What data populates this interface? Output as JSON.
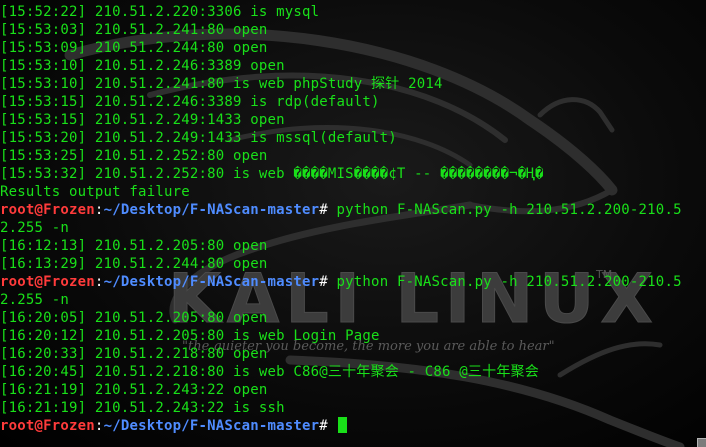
{
  "terminal": {
    "lines": [
      {
        "type": "output",
        "text": "[15:52:22] 210.51.2.220:3306 is mysql"
      },
      {
        "type": "output",
        "text": "[15:53:03] 210.51.2.241:80 open"
      },
      {
        "type": "output",
        "text": "[15:53:09] 210.51.2.244:80 open"
      },
      {
        "type": "output",
        "text": "[15:53:10] 210.51.2.246:3389 open"
      },
      {
        "type": "output",
        "text": "[15:53:10] 210.51.2.241:80 is web phpStudy 探针 2014"
      },
      {
        "type": "output",
        "text": "[15:53:15] 210.51.2.246:3389 is rdp(default)"
      },
      {
        "type": "output",
        "text": "[15:53:15] 210.51.2.249:1433 open"
      },
      {
        "type": "output",
        "text": "[15:53:20] 210.51.2.249:1433 is mssql(default)"
      },
      {
        "type": "output",
        "text": "[15:53:25] 210.51.2.252:80 open"
      },
      {
        "type": "output",
        "text": "[15:53:32] 210.51.2.252:80 is web ����MIS����¢T -- ��������¬�Ң�"
      },
      {
        "type": "output",
        "text": "Results output failure"
      },
      {
        "type": "prompt",
        "user": "root@Frozen",
        "sep": ":",
        "path": "~/Desktop/F-NAScan-master",
        "hash": "# ",
        "cmd": "python F-NAScan.py -h 210.51.2.200-210.5"
      },
      {
        "type": "output",
        "text": "2.255 -n"
      },
      {
        "type": "output",
        "text": "[16:12:13] 210.51.2.205:80 open"
      },
      {
        "type": "output",
        "text": "[16:13:29] 210.51.2.244:80 open"
      },
      {
        "type": "prompt",
        "user": "root@Frozen",
        "sep": ":",
        "path": "~/Desktop/F-NAScan-master",
        "hash": "# ",
        "cmd": "python F-NAScan.py -h 210.51.2.200-210.5"
      },
      {
        "type": "output",
        "text": "2.255 -n"
      },
      {
        "type": "output",
        "text": "[16:20:05] 210.51.2.205:80 open"
      },
      {
        "type": "output",
        "text": "[16:20:12] 210.51.2.205:80 is web Login Page"
      },
      {
        "type": "output",
        "text": "[16:20:33] 210.51.2.218:80 open"
      },
      {
        "type": "output",
        "text": "[16:20:45] 210.51.2.218:80 is web C86@三十年聚会 - C86 @三十年聚会"
      },
      {
        "type": "output",
        "text": "[16:21:19] 210.51.2.243:22 open"
      },
      {
        "type": "output",
        "text": "[16:21:19] 210.51.2.243:22 is ssh"
      },
      {
        "type": "prompt",
        "user": "root@Frozen",
        "sep": ":",
        "path": "~/Desktop/F-NAScan-master",
        "hash": "# ",
        "cmd": "",
        "cursor": true
      }
    ]
  },
  "wallpaper": {
    "logo_text": "KALI LINUX",
    "trademark": "TM",
    "tagline": "\"the quieter you become, the more you are able to hear\""
  },
  "colors": {
    "output_text": "#19e019",
    "prompt_user": "#ff3b3b",
    "prompt_path": "#4f8cff",
    "background": "#000000"
  }
}
